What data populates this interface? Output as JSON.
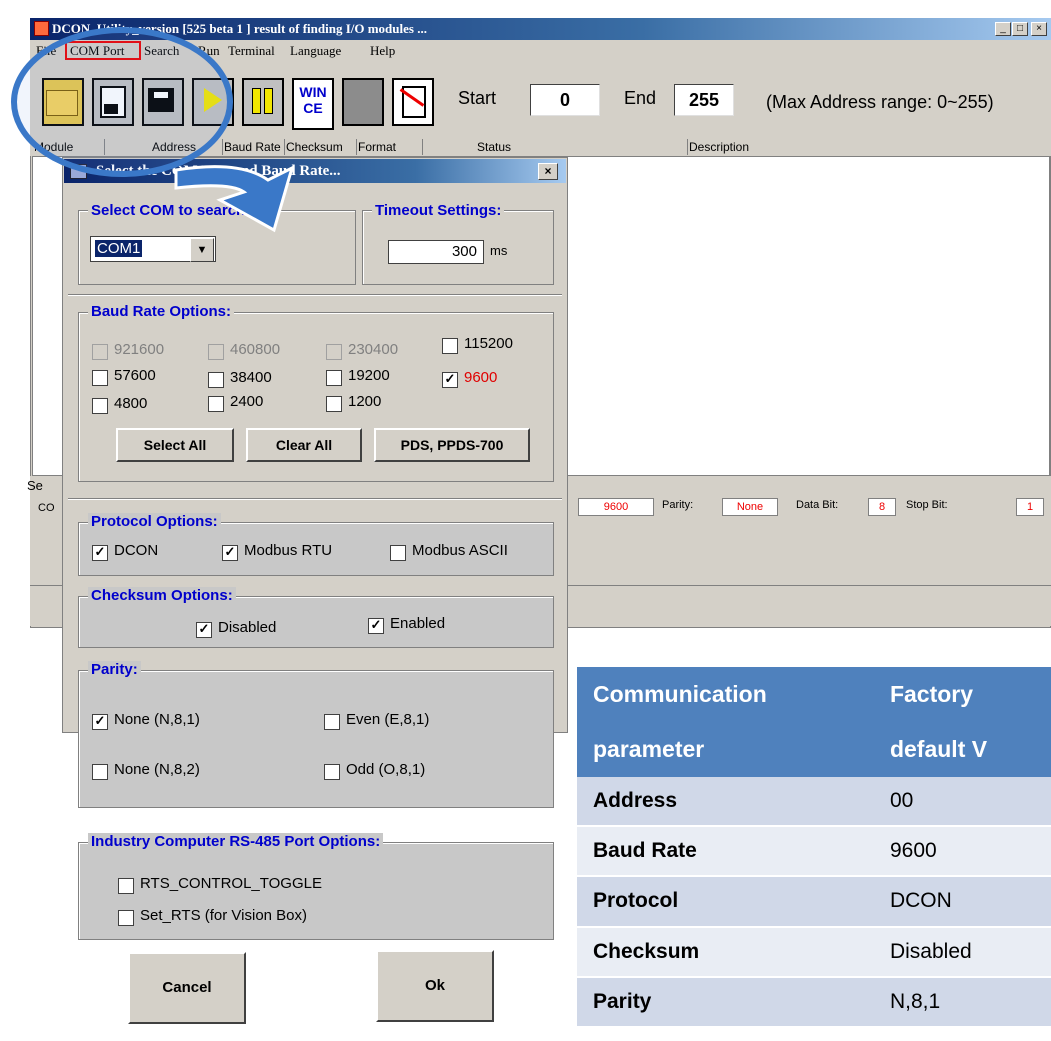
{
  "window": {
    "title": "DCON_Utility_version [525 beta 1  ] result of finding I/O modules ...",
    "min_btn": "_",
    "max_btn": "□",
    "close_btn": "×"
  },
  "menu": [
    "File",
    "COM Port",
    "Search",
    "Run",
    "Terminal",
    "Language",
    "Help"
  ],
  "toolbar": {
    "wince_label": "WIN\nCE",
    "start_label": "Start",
    "start_value": "0",
    "end_label": "End",
    "end_value": "255",
    "range_label": "(Max Address range: 0~255)"
  },
  "columns": [
    "Module",
    "Address",
    "Baud Rate",
    "Checksum",
    "Format",
    "Status",
    "Description"
  ],
  "status_strip": {
    "left_label": "Se",
    "left_sub": "CO",
    "baud_value": "9600",
    "parity_label": "Parity:",
    "parity_value": "None",
    "data_bit_label": "Data Bit:",
    "data_bit_value": "8",
    "stop_bit_label": "Stop Bit:",
    "stop_bit_value": "1"
  },
  "dialog": {
    "title": "Select the COM Port and Baud Rate...",
    "close": "×",
    "com_group_title": "Select COM to search:",
    "com_value": "COM1",
    "timeout_group_title": "Timeout Settings:",
    "timeout_value": "300",
    "timeout_unit": "ms",
    "baud_group_title": "Baud Rate Options:",
    "baud_rates": [
      {
        "label": "921600",
        "checked": false,
        "disabled": true
      },
      {
        "label": "460800",
        "checked": false,
        "disabled": true
      },
      {
        "label": "230400",
        "checked": false,
        "disabled": true
      },
      {
        "label": "115200",
        "checked": false,
        "disabled": false
      },
      {
        "label": "57600",
        "checked": false,
        "disabled": false
      },
      {
        "label": "38400",
        "checked": false,
        "disabled": false
      },
      {
        "label": "19200",
        "checked": false,
        "disabled": false
      },
      {
        "label": "9600",
        "checked": true,
        "disabled": false
      },
      {
        "label": "4800",
        "checked": false,
        "disabled": false
      },
      {
        "label": "2400",
        "checked": false,
        "disabled": false
      },
      {
        "label": "1200",
        "checked": false,
        "disabled": false
      }
    ],
    "select_all": "Select All",
    "clear_all": "Clear All",
    "pds_btn": "PDS, PPDS-700",
    "protocol_group_title": "Protocol Options:",
    "protocols": [
      {
        "label": "DCON",
        "checked": true
      },
      {
        "label": "Modbus RTU",
        "checked": true
      },
      {
        "label": "Modbus ASCII",
        "checked": false
      }
    ],
    "checksum_group_title": "Checksum  Options:",
    "checksums": [
      {
        "label": "Disabled",
        "checked": true
      },
      {
        "label": "Enabled",
        "checked": true
      }
    ],
    "parity_group_title": "Parity:",
    "parities": [
      {
        "label": "None (N,8,1)",
        "checked": true
      },
      {
        "label": "Even (E,8,1)",
        "checked": false
      },
      {
        "label": "None (N,8,2)",
        "checked": false
      },
      {
        "label": "Odd (O,8,1)",
        "checked": false
      }
    ],
    "rs485_group_title": "Industry Computer RS-485 Port Options:",
    "rs485": [
      {
        "label": "RTS_CONTROL_TOGGLE",
        "checked": false
      },
      {
        "label": "Set_RTS (for Vision Box)",
        "checked": false
      }
    ],
    "cancel": "Cancel",
    "ok": "Ok"
  },
  "param_table": {
    "headers": [
      [
        "Communication",
        "parameter"
      ],
      [
        "Factory",
        "default V"
      ]
    ],
    "rows": [
      {
        "param": "Address",
        "value": "00"
      },
      {
        "param": "Baud Rate",
        "value": "9600"
      },
      {
        "param": "Protocol",
        "value": "DCON"
      },
      {
        "param": "Checksum",
        "value": "Disabled"
      },
      {
        "param": "Parity",
        "value": "N,8,1"
      }
    ]
  },
  "colors": {
    "highlight_red": "#e00000",
    "circle_blue": "#3a78c8",
    "table_header": "#4f81bd",
    "table_row": "#d0d8e8",
    "table_row_alt": "#e9edf4",
    "group_title_blue": "#0000cc"
  }
}
